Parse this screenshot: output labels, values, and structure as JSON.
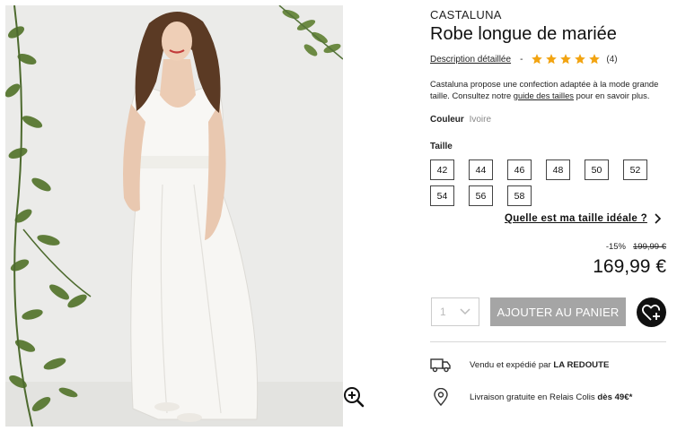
{
  "product": {
    "brand": "CASTALUNA",
    "title": "Robe longue de mariée",
    "description_link": "Description détaillée",
    "separator": "-",
    "rating_stars": 5,
    "review_count": "(4)",
    "blurb_before": "Castaluna propose une confection adaptée à la mode grande taille. Consultez notre ",
    "blurb_link": "guide des tailles",
    "blurb_after": " pour en savoir plus."
  },
  "color": {
    "label": "Couleur",
    "value": "Ivoire"
  },
  "sizes": {
    "label": "Taille",
    "options": [
      "42",
      "44",
      "46",
      "48",
      "50",
      "52",
      "54",
      "56",
      "58"
    ],
    "guide_link": "Quelle est ma taille idéale ?"
  },
  "pricing": {
    "discount": "-15%",
    "old_price": "199,99 €",
    "price": "169,99 €"
  },
  "cart": {
    "quantity": "1",
    "add_button": "AJOUTER AU PANIER"
  },
  "shipping": {
    "seller_prefix": "Vendu et expédié par ",
    "seller_name": "LA REDOUTE",
    "delivery_prefix": "Livraison gratuite en Relais Colis ",
    "delivery_bold": "dès 49€*"
  },
  "icons": {
    "zoom": "zoom-in-icon",
    "star": "star-icon",
    "chevron": "chevron-right-icon",
    "dropdown": "chevron-down-icon",
    "wishlist": "heart-plus-icon",
    "truck": "truck-icon",
    "location": "location-pin-icon"
  },
  "colors": {
    "star": "#f2a411",
    "add_button_bg": "#a5a5a5",
    "wishlist_bg": "#111111"
  }
}
